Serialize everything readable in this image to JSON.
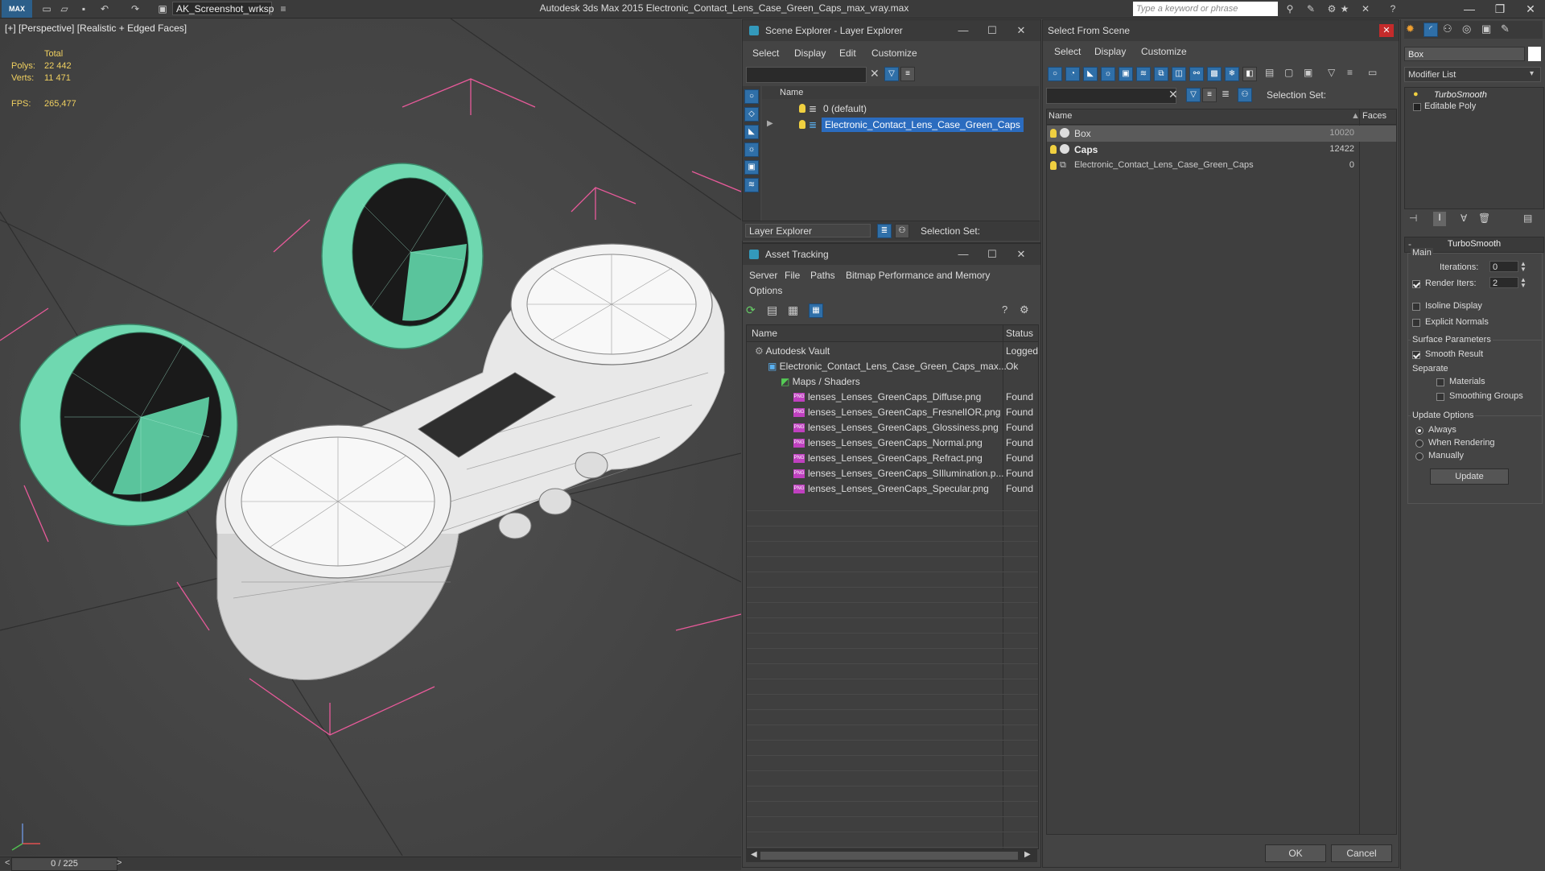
{
  "titlebar": {
    "logo": "MAX",
    "workspace": "AK_Screenshot_wrksp",
    "app_title": "Autodesk 3ds Max  2015     Electronic_Contact_Lens_Case_Green_Caps_max_vray.max",
    "search_placeholder": "Type a keyword or phrase"
  },
  "viewport": {
    "label": "[+] [Perspective] [Realistic + Edged Faces]",
    "stats": {
      "total_label": "Total",
      "polys_label": "Polys:",
      "polys_value": "22 442",
      "verts_label": "Verts:",
      "verts_value": "11 471",
      "fps_label": "FPS:",
      "fps_value": "265,477"
    },
    "timeline": "0 / 225",
    "prev": "<",
    "next": ">"
  },
  "scene_explorer": {
    "title": "Scene Explorer - Layer Explorer",
    "menu": [
      "Select",
      "Display",
      "Edit",
      "Customize"
    ],
    "column_name": "Name",
    "rows": [
      "0 (default)",
      "Electronic_Contact_Lens_Case_Green_Caps"
    ],
    "footer_label": "Layer Explorer",
    "selection_set": "Selection Set:"
  },
  "asset_tracking": {
    "title": "Asset Tracking",
    "menu": [
      "Server",
      "File",
      "Paths",
      "Bitmap Performance and Memory"
    ],
    "menu2": "Options",
    "col_name": "Name",
    "col_status": "Status",
    "rows": [
      {
        "name": "Autodesk Vault",
        "status": "Logged",
        "indent": 0
      },
      {
        "name": "Electronic_Contact_Lens_Case_Green_Caps_max...",
        "status": "Ok",
        "indent": 1
      },
      {
        "name": "Maps / Shaders",
        "status": "",
        "indent": 2
      },
      {
        "name": "lenses_Lenses_GreenCaps_Diffuse.png",
        "status": "Found",
        "indent": 3
      },
      {
        "name": "lenses_Lenses_GreenCaps_FresnelIOR.png",
        "status": "Found",
        "indent": 3
      },
      {
        "name": "lenses_Lenses_GreenCaps_Glossiness.png",
        "status": "Found",
        "indent": 3
      },
      {
        "name": "lenses_Lenses_GreenCaps_Normal.png",
        "status": "Found",
        "indent": 3
      },
      {
        "name": "lenses_Lenses_GreenCaps_Refract.png",
        "status": "Found",
        "indent": 3
      },
      {
        "name": "lenses_Lenses_GreenCaps_SIllumination.p...",
        "status": "Found",
        "indent": 3
      },
      {
        "name": "lenses_Lenses_GreenCaps_Specular.png",
        "status": "Found",
        "indent": 3
      }
    ]
  },
  "select_from_scene": {
    "title": "Select From Scene",
    "menu": [
      "Select",
      "Display",
      "Customize"
    ],
    "selection_set": "Selection Set:",
    "col_name": "Name",
    "col_faces": "Faces",
    "rows": [
      {
        "name": "Box",
        "faces": "10020"
      },
      {
        "name": "Caps",
        "faces": "12422"
      },
      {
        "name": "Electronic_Contact_Lens_Case_Green_Caps",
        "faces": "0"
      }
    ],
    "ok": "OK",
    "cancel": "Cancel"
  },
  "command_panel": {
    "object_name": "Box",
    "modifier_list": "Modifier List",
    "stack": [
      "TurboSmooth",
      "Editable Poly"
    ],
    "rollout_title": "TurboSmooth",
    "main_label": "Main",
    "iterations_label": "Iterations:",
    "iterations_value": "0",
    "render_iters_label": "Render Iters:",
    "render_iters_value": "2",
    "isoline_label": "Isoline Display",
    "explicit_label": "Explicit Normals",
    "surface_label": "Surface Parameters",
    "smooth_label": "Smooth Result",
    "separate_label": "Separate",
    "materials_label": "Materials",
    "smoothing_label": "Smoothing Groups",
    "update_options_label": "Update Options",
    "always_label": "Always",
    "when_rendering_label": "When Rendering",
    "manually_label": "Manually",
    "update_button": "Update"
  },
  "colors": {
    "selection": "#2b6cbf",
    "cap_green": "#6fd8b0",
    "wire": "#f060a0"
  }
}
